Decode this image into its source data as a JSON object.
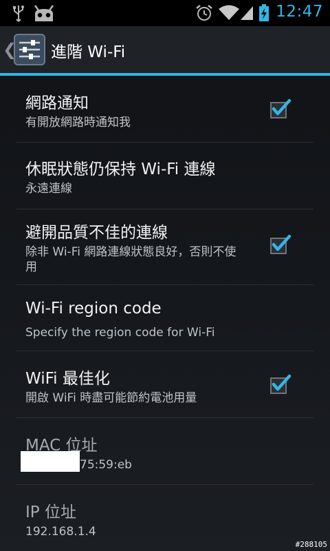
{
  "status_bar": {
    "clock": "12:47",
    "icons": [
      "usb-icon",
      "android-debug-icon",
      "alarm-icon",
      "wifi-signal-icon",
      "cell-signal-icon",
      "battery-charging-icon"
    ],
    "accent_color": "#33b5e5"
  },
  "action_bar": {
    "title": "進階 Wi-Fi",
    "icon": "settings-sliders-icon"
  },
  "preferences": [
    {
      "title": "網路通知",
      "summary": "有開放網路時通知我",
      "checked": true
    },
    {
      "title": "休眠狀態仍保持 Wi-Fi 連線",
      "summary": "永遠連線"
    },
    {
      "title": "避開品質不佳的連線",
      "summary": "除非 Wi-Fi 網路連線狀態良好，否則不使用",
      "checked": true
    },
    {
      "title": "Wi-Fi region code",
      "summary": "Specify the region code for Wi-Fi"
    },
    {
      "title": "WiFi 最佳化",
      "summary": "開啟 WiFi 時盡可能節約電池用量",
      "checked": true
    },
    {
      "title": "MAC 位址",
      "summary": "75:59:eb"
    },
    {
      "title": "IP 位址",
      "summary": "192.168.1.4"
    }
  ],
  "watermark": "#288105"
}
